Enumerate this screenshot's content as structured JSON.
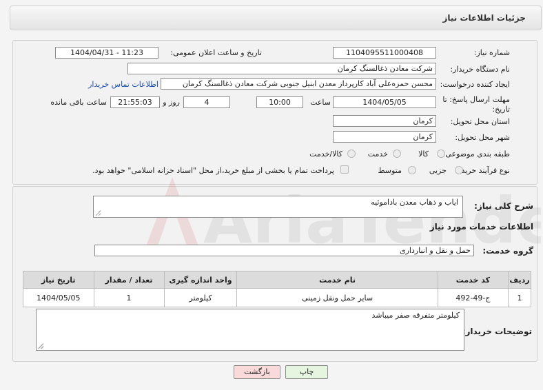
{
  "header": {
    "title": "جزئیات اطلاعات نیاز"
  },
  "fields": {
    "need_number_label": "شماره نیاز:",
    "need_number": "1104095511000408",
    "announce_label": "تاریخ و ساعت اعلان عمومی:",
    "announce_value": "1404/04/31 - 11:23",
    "buyer_org_label": "نام دستگاه خریدار:",
    "buyer_org": "شرکت معادن ذغالسنگ کرمان",
    "requester_label": "ایجاد کننده درخواست:",
    "requester": "محسن حمزه‌علی آباد کارپرداز معدن ابنیل جنوبی شرکت معادن ذغالسنگ کرمان",
    "contact_link": "اطلاعات تماس خریدار",
    "deadline_label_1": "مهلت ارسال پاسخ: تا",
    "deadline_label_2": "تاریخ:",
    "deadline_date": "1404/05/05",
    "time_label": "ساعت",
    "deadline_time": "10:00",
    "days_value": "4",
    "days_label": "روز و",
    "remaining_time": "21:55:03",
    "remaining_label": "ساعت باقی مانده",
    "province_label": "استان محل تحویل:",
    "province": "کرمان",
    "city_label": "شهر محل تحویل:",
    "city": "کرمان",
    "category_label": "طبقه بندی موضوعی:",
    "category_options": [
      "کالا",
      "خدمت",
      "کالا/خدمت"
    ],
    "process_label": "نوع فرآیند خرید :",
    "process_options": [
      "جزیی",
      "متوسط"
    ],
    "treasury_note": "پرداخت تمام یا بخشی از مبلغ خرید،از محل \"اسناد خزانه اسلامی\" خواهد بود."
  },
  "summary": {
    "label": "شرح کلی نیاز:",
    "value": "ایاب و ذهاب معدن باداموئیه"
  },
  "services": {
    "section_title": "اطلاعات خدمات مورد نیاز",
    "group_label": "گروه خدمت:",
    "group_value": "حمل و نقل و انبارداری",
    "table_headers": [
      "ردیف",
      "کد خدمت",
      "نام خدمت",
      "واحد اندازه گیری",
      "تعداد / مقدار",
      "تاریخ نیاز"
    ],
    "rows": [
      [
        "1",
        "ج-49-492",
        "سایر حمل ونقل زمینی",
        "کیلومتر",
        "1",
        "1404/05/05"
      ]
    ]
  },
  "buyer_notes": {
    "label": "توضیحات خریدار:",
    "value": "کیلومتر متفرقه صفر میباشد"
  },
  "buttons": {
    "print": "چاپ",
    "back": "بازگشت"
  },
  "watermark": {
    "text": "AriaTender.neT"
  },
  "colors": {
    "link": "#1a4ea8",
    "back_button_bg": "#f9d9d9",
    "print_button_bg": "#e6f5df",
    "watermark": "#c0392b"
  }
}
